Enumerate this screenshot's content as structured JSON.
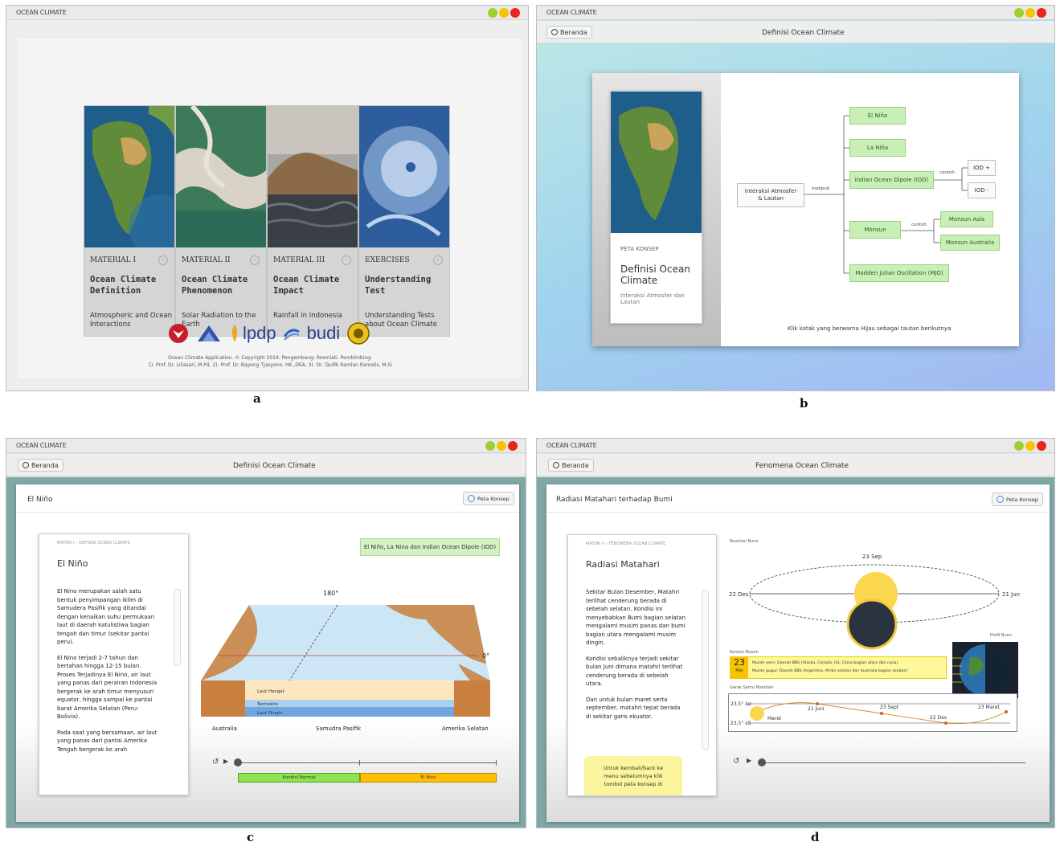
{
  "app_title": "OCEAN CLIMATE",
  "colors": {
    "dot_green": "#9bd130",
    "dot_yellow": "#f6c400",
    "dot_red": "#e8261a",
    "node_green": "#c8efb5",
    "timeline_green": "#8de44c",
    "timeline_orange": "#ffbf00"
  },
  "captions": {
    "a": "a",
    "b": "b",
    "c": "c",
    "d": "d"
  },
  "panel_a": {
    "cards": [
      {
        "label": "MATERIAL I",
        "title": "Ocean Climate Definition",
        "subtitle": "Atmospheric and Ocean Interactions"
      },
      {
        "label": "MATERIAL II",
        "title": "Ocean Climate Phenomenon",
        "subtitle": "Solar Radiation to the Earth"
      },
      {
        "label": "MATERIAL III",
        "title": "Ocean Climate Impact",
        "subtitle": "Rainfall in Indonesia"
      },
      {
        "label": "EXERCISES",
        "title": "Understanding Test",
        "subtitle": "Understanding Tests about Ocean Climate"
      }
    ],
    "logos": {
      "lpdp": "lpdp",
      "budi": "budi"
    },
    "copyright_line1": "Ocean Climate Application. © Copyright 2019. Pengembang: Rosmiati. Pembimbing:",
    "copyright_line2": "1). Prof. Dr. Liliasari, M.Pd, 2). Prof. Dr. Bayong Tjasyono, HK.,DEA, 3). Dr. Taufik Ramlan Ramalis, M.Si"
  },
  "panel_b": {
    "home_button": "Beranda",
    "header_title": "Definisi Ocean Climate",
    "card_label": "PETA KONSEP",
    "card_title": "Definisi Ocean Climate",
    "card_subtitle": "Interaksi Atmosfer dan Lautan",
    "root_node": "Interaksi Atmosfer & Lautan",
    "edge_meliputi": "meliputi",
    "edge_contoh_1": "contoh",
    "edge_contoh_2": "contoh",
    "nodes": {
      "el_nino": "El Niño",
      "la_nina": "La Niña",
      "iod": "Indian Ocean Dipole (IOD)",
      "monsun": "Monsun",
      "mjo": "Madden Julian Oscillation (MJO)",
      "iod_plus": "IOD +",
      "iod_minus": "IOD -",
      "monsun_asia": "Monsun Asia",
      "monsun_australia": "Monsun Australia"
    },
    "instruction": "Klik kotak yang berwarna Hijau sebagai tautan berikutnya"
  },
  "panel_c": {
    "home_button": "Beranda",
    "header_title": "Definisi Ocean Climate",
    "page_heading": "El Niño",
    "peta_button": "Peta Konsep",
    "breadcrumb": "MATERI I – DEFINISI OCEAN CLIMATE",
    "card_title": "El Niño",
    "paragraphs": [
      "El Nino merupakan salah satu bentuk penyimpangan iklim di Samudera Pasifik yang ditandai dengan kenaikan suhu permukaan laut di daerah katulistiwa bagian tengah dan timur (sekitar pantai peru).",
      "El Nino terjadi 2-7 tahun dan bertahan hingga 12-15 bulan. Proses Terjadinya El Nino, air laut yang panas dari perairan Indonesia bergerak ke arah timur menyusuri equator, hingga sampai ke pantai barat Amerika Selatan (Peru-Bolivia).",
      "Pada saat yang bersamaan, air laut yang panas dari pantai Amerika Tengah bergerak ke arah"
    ],
    "topic_badge": "El Niño, La Nina dan Indian Ocean Dipole (IOD)",
    "diagram": {
      "lon_label": "180°",
      "lat_label": "0°",
      "laut_hangat": "Laut Hangat",
      "termoklin": "Termoklin",
      "laut_dingin": "Laut Dingin",
      "australia": "Australia",
      "samudra": "Samudra Pasifik",
      "amerika": "Amerika Selatan"
    },
    "timeline": {
      "normal": "Kondisi Normal",
      "elnino": "El Niño"
    }
  },
  "panel_d": {
    "home_button": "Beranda",
    "header_title": "Fenomena Ocean Climate",
    "page_heading": "Radiasi Matahari terhadap Bumi",
    "peta_button": "Peta Konsep",
    "breadcrumb": "MATERI II – FENOMENA OCEAN CLIMATE",
    "card_title": "Radiasi Matahari",
    "paragraphs": [
      "Sekitar Bulan Desember, Matahri terlihat cenderung berada di sebelah selatan. Kondisi ini menyebabkan Bumi bagian selatan mengalami musim panas dan bumi bagian utara mengalami musim dingin.",
      "Kondisi sebaliknya terjadi sekitar bulan Juni dimana matahri terlihat cenderung berada di sebelah utara.",
      "Dan untuk bulan maret serta september, matahri tepat berada di sekitar garis ekuator."
    ],
    "note": "Untuk kembali/back ke menu sebelumnya klik tombol peta konsep di",
    "revolusi_label": "Revolusi Bumi",
    "sep": "23 Sep",
    "des": "22 Des",
    "jun": "21 Jun",
    "profil_label": "Profil Bumi",
    "kondisi_label": "Kondisi Musim",
    "date_number": "23",
    "date_month": "Mar",
    "musim_semi": "Musim semi: Daerah BBU (Alaska, Canada, US, China bagian utara dan rusia)",
    "musim_gugur": "Musim gugur: Daerah BBS (Argentina, Afrika selatan dan Australia bagian selatan)",
    "gerak_label": "Gerak Semu Matahari",
    "lu": "23,5° LU",
    "ls": "23,5° LS",
    "g_21juni": "21 Juni",
    "g_23sept": "23 Sept",
    "g_23maret_right": "23 Maret",
    "g_maret_left": "Maret",
    "g_22des": "22 Des"
  }
}
